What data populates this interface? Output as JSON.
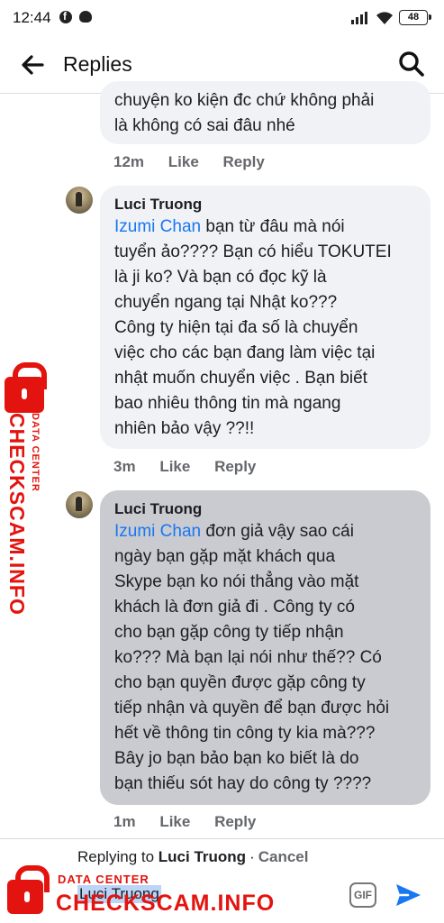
{
  "status_bar": {
    "time": "12:44",
    "battery": "48"
  },
  "header": {
    "title": "Replies"
  },
  "comments": [
    {
      "text_lines": [
        "chuyện ko kiện đc chứ không phải",
        "là không có sai đâu nhé"
      ],
      "time": "12m",
      "like": "Like",
      "reply": "Reply"
    },
    {
      "author": "Luci Truong",
      "mention": "Izumi Chan",
      "first_line_rest": " bạn từ đâu mà nói",
      "text_lines": [
        "tuyển ảo???? Bạn có hiểu TOKUTEI",
        "là ji ko? Và bạn có đọc kỹ là",
        "chuyển ngang tại Nhật ko???",
        "Công ty hiện tại đa số là chuyển",
        "việc cho các bạn đang làm việc tại",
        "nhật muốn chuyển việc . Bạn biết",
        "bao nhiêu thông tin mà ngang",
        "nhiên bảo vậy ??!!"
      ],
      "time": "3m",
      "like": "Like",
      "reply": "Reply"
    },
    {
      "author": "Luci Truong",
      "mention": "Izumi Chan",
      "first_line_rest": " đơn giả vậy sao cái",
      "text_lines": [
        "ngày bạn gặp mặt khách qua",
        "Skype bạn ko nói thẳng vào mặt",
        "khách là đơn giả đi . Công ty có",
        "cho bạn gặp công ty tiếp nhận",
        "ko??? Mà bạn lại nói như thế?? Có",
        "cho bạn quyền được gặp công ty",
        "tiếp nhận và quyền để bạn được hỏi",
        "hết về thông tin công ty kia mà???",
        "Bây jo bạn bảo bạn ko biết là do",
        "bạn thiếu sót hay do công ty ????"
      ],
      "time": "1m",
      "like": "Like",
      "reply": "Reply"
    }
  ],
  "reply_bar": {
    "prefix": "Replying to ",
    "name": "Luci Truong",
    "separator": "·",
    "cancel": "Cancel",
    "input_value": "Luci Truong",
    "gif_label": "GIF"
  },
  "watermark": {
    "small": "DATA CENTER",
    "big": "CHECKSCAM.INFO"
  },
  "colors": {
    "mention": "#1877f2",
    "bubble": "#f0f2f5",
    "bubble_selected": "#c9cbd0",
    "send": "#1877f2",
    "watermark": "#e3140f"
  }
}
